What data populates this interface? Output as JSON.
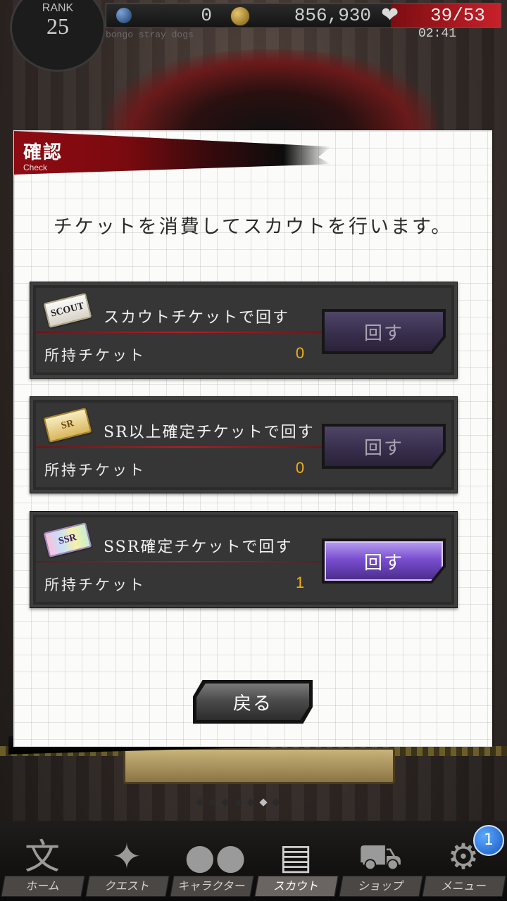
{
  "status": {
    "rank_label": "RANK",
    "rank_value": "25",
    "gems": "0",
    "money": "856,930",
    "stamina": "39/53",
    "timer": "02:41",
    "subtitle": "bongo stray dogs"
  },
  "dialog": {
    "title": "確認",
    "subtitle": "Check",
    "message": "チケットを消費してスカウトを行います。",
    "rows": [
      {
        "ticket_icon": "scout-ticket-icon",
        "ticket_text": "SCOUT",
        "label": "スカウトチケットで回す",
        "owned_label": "所持チケット",
        "owned_count": "0",
        "button": "回す",
        "button_enabled": false
      },
      {
        "ticket_icon": "sr-ticket-icon",
        "ticket_text": "SR",
        "label": "SR以上確定チケットで回す",
        "owned_label": "所持チケット",
        "owned_count": "0",
        "button": "回す",
        "button_enabled": false
      },
      {
        "ticket_icon": "ssr-ticket-icon",
        "ticket_text": "SSR",
        "label": "SSR確定チケットで回す",
        "owned_label": "所持チケット",
        "owned_count": "1",
        "button": "回す",
        "button_enabled": true
      }
    ],
    "back_button": "戻る"
  },
  "pager": {
    "count": 7,
    "active_index": 5
  },
  "nav": {
    "items": [
      {
        "label": "ホーム",
        "icon": "bungo-home-icon"
      },
      {
        "label": "クエスト",
        "icon": "tiger-quest-icon"
      },
      {
        "label": "キャラクター",
        "icon": "characters-icon"
      },
      {
        "label": "スカウト",
        "icon": "book-scout-icon"
      },
      {
        "label": "ショップ",
        "icon": "cart-shop-icon"
      },
      {
        "label": "メニュー",
        "icon": "gear-menu-icon"
      }
    ],
    "active_index": 3,
    "menu_badge": "1"
  },
  "colors": {
    "header_red": "#8e0b12",
    "count_orange": "#f0b01a",
    "button_purple": "#7a4fd0",
    "stamina_red": "#c8202a"
  }
}
